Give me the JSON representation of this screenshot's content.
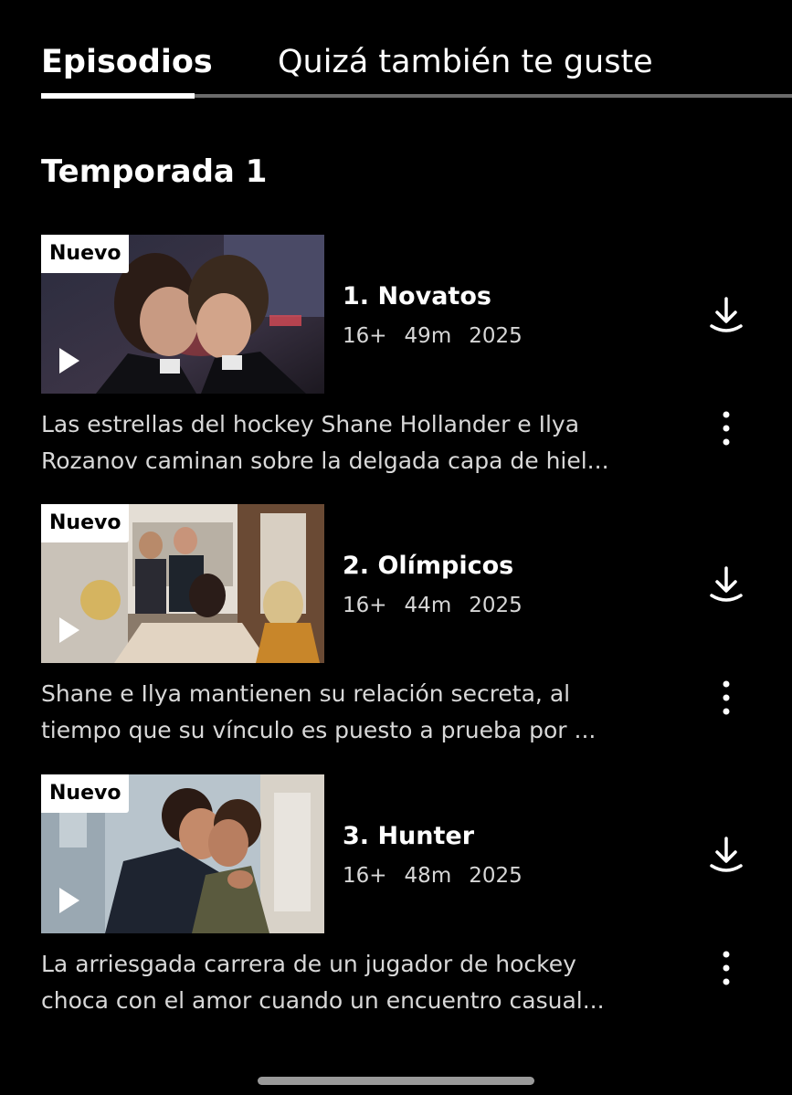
{
  "tabs": [
    {
      "label": "Episodios",
      "active": true
    },
    {
      "label": "Quizá también te guste",
      "active": false
    }
  ],
  "season": {
    "title": "Temporada 1"
  },
  "episodes": [
    {
      "badge": "Nuevo",
      "title": "1. Novatos",
      "rating": "16+",
      "duration": "49m",
      "year": "2025",
      "description_lines": [
        "Las estrellas del hockey Shane Hollander e Ilya",
        "Rozanov caminan sobre la delgada capa de hiel..."
      ]
    },
    {
      "badge": "Nuevo",
      "title": "2. Olímpicos",
      "rating": "16+",
      "duration": "44m",
      "year": "2025",
      "description_lines": [
        "Shane e Ilya mantienen su relación secreta, al",
        "tiempo que su vínculo es puesto a prueba por ..."
      ]
    },
    {
      "badge": "Nuevo",
      "title": "3. Hunter",
      "rating": "16+",
      "duration": "48m",
      "year": "2025",
      "description_lines": [
        "La arriesgada carrera de un jugador de hockey",
        "choca con el amor cuando un encuentro casual..."
      ]
    }
  ],
  "icons": {
    "play": "play-icon",
    "download": "download-icon",
    "more": "more-vertical-icon"
  },
  "colors": {
    "background": "#000000",
    "text": "#ffffff",
    "secondary_text": "#d6d6d6",
    "tab_track": "#6b6b6b",
    "badge_bg": "#ffffff",
    "badge_text": "#000000"
  }
}
